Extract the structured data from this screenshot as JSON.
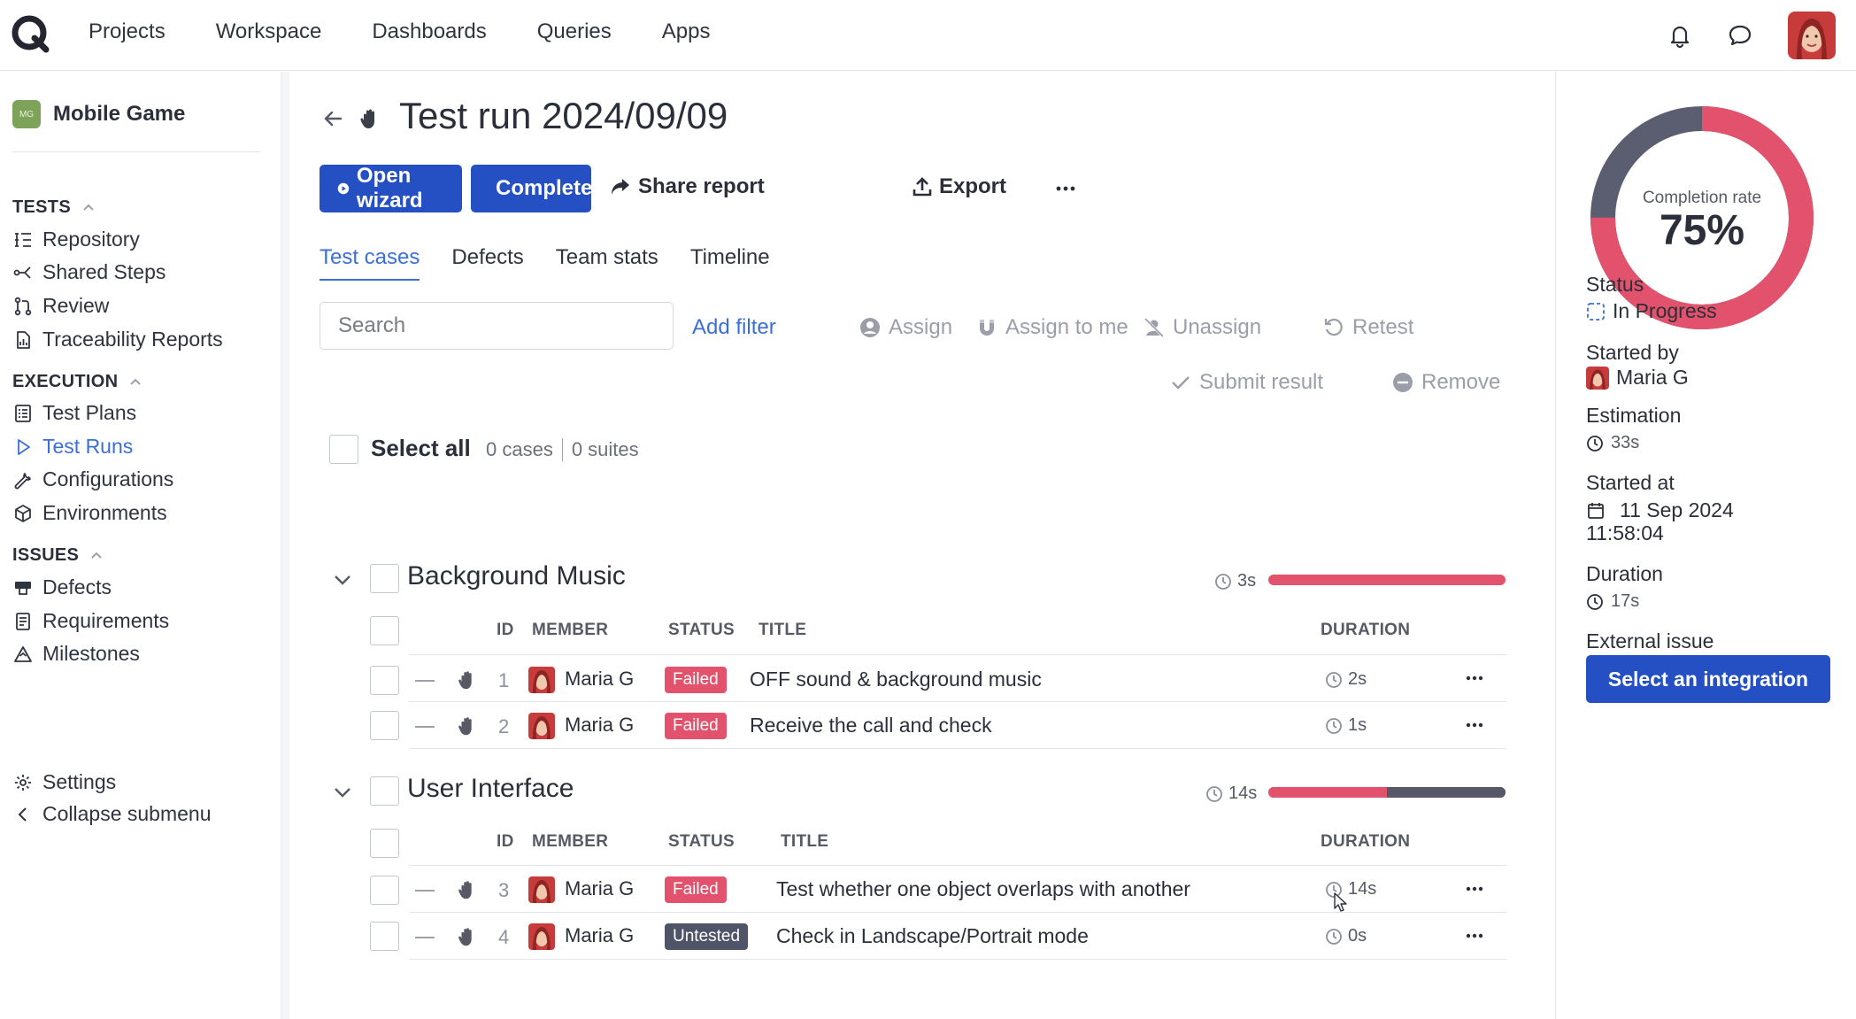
{
  "topnav": {
    "items": [
      "Projects",
      "Workspace",
      "Dashboards",
      "Queries",
      "Apps"
    ]
  },
  "sidebar": {
    "project": {
      "badge": "MG",
      "name": "Mobile Game"
    },
    "sections": {
      "tests": "TESTS",
      "execution": "EXECUTION",
      "issues": "ISSUES"
    },
    "tests_items": [
      "Repository",
      "Shared Steps",
      "Review",
      "Traceability Reports"
    ],
    "execution_items": [
      "Test Plans",
      "Test Runs",
      "Configurations",
      "Environments"
    ],
    "issues_items": [
      "Defects",
      "Requirements",
      "Milestones"
    ],
    "footer": {
      "settings": "Settings",
      "collapse": "Collapse submenu"
    }
  },
  "main": {
    "title": "Test run 2024/09/09",
    "toolbar": {
      "open_wizard": "Open wizard",
      "complete": "Complete",
      "share_report": "Share report",
      "export": "Export"
    },
    "tabs": [
      "Test cases",
      "Defects",
      "Team stats",
      "Timeline"
    ],
    "search_placeholder": "Search",
    "add_filter": "Add filter",
    "actions": {
      "assign": "Assign",
      "assign_to_me": "Assign to me",
      "unassign": "Unassign",
      "retest": "Retest",
      "submit_result": "Submit result",
      "remove": "Remove"
    },
    "select_all": "Select all",
    "cases_count": "0 cases",
    "suites_count": "0 suites",
    "columns": {
      "id": "ID",
      "member": "MEMBER",
      "status": "STATUS",
      "title": "TITLE",
      "duration": "DURATION"
    },
    "suites": [
      {
        "name": "Background Music",
        "duration": "3s",
        "progress": {
          "failed": 1.0,
          "untested": 0.0
        },
        "rows": [
          {
            "id": "1",
            "member": "Maria G",
            "status": "Failed",
            "title": "OFF sound & background music",
            "duration": "2s"
          },
          {
            "id": "2",
            "member": "Maria G",
            "status": "Failed",
            "title": "Receive the call and check",
            "duration": "1s"
          }
        ]
      },
      {
        "name": "User Interface",
        "duration": "14s",
        "progress": {
          "failed": 0.5,
          "untested": 0.5
        },
        "rows": [
          {
            "id": "3",
            "member": "Maria G",
            "status": "Failed",
            "title": "Test whether one object overlaps with another",
            "duration": "14s"
          },
          {
            "id": "4",
            "member": "Maria G",
            "status": "Untested",
            "title": "Check in Landscape/Portrait mode",
            "duration": "0s"
          }
        ]
      }
    ]
  },
  "details": {
    "completion_label": "Completion rate",
    "completion_value": "75%",
    "completion_fraction": 0.75,
    "status_label": "Status",
    "status_value": "In Progress",
    "started_by_label": "Started by",
    "started_by_value": "Maria G",
    "estimation_label": "Estimation",
    "estimation_value": "33s",
    "started_at_label": "Started at",
    "started_at_date": "11 Sep 2024",
    "started_at_time": "11:58:04",
    "duration_label": "Duration",
    "duration_value": "17s",
    "external_issue_label": "External issue",
    "integration_button": "Select an integration"
  },
  "colors": {
    "primary": "#2450c4",
    "link": "#3a6fd8",
    "failed": "#e2526c",
    "untested": "#505468"
  }
}
